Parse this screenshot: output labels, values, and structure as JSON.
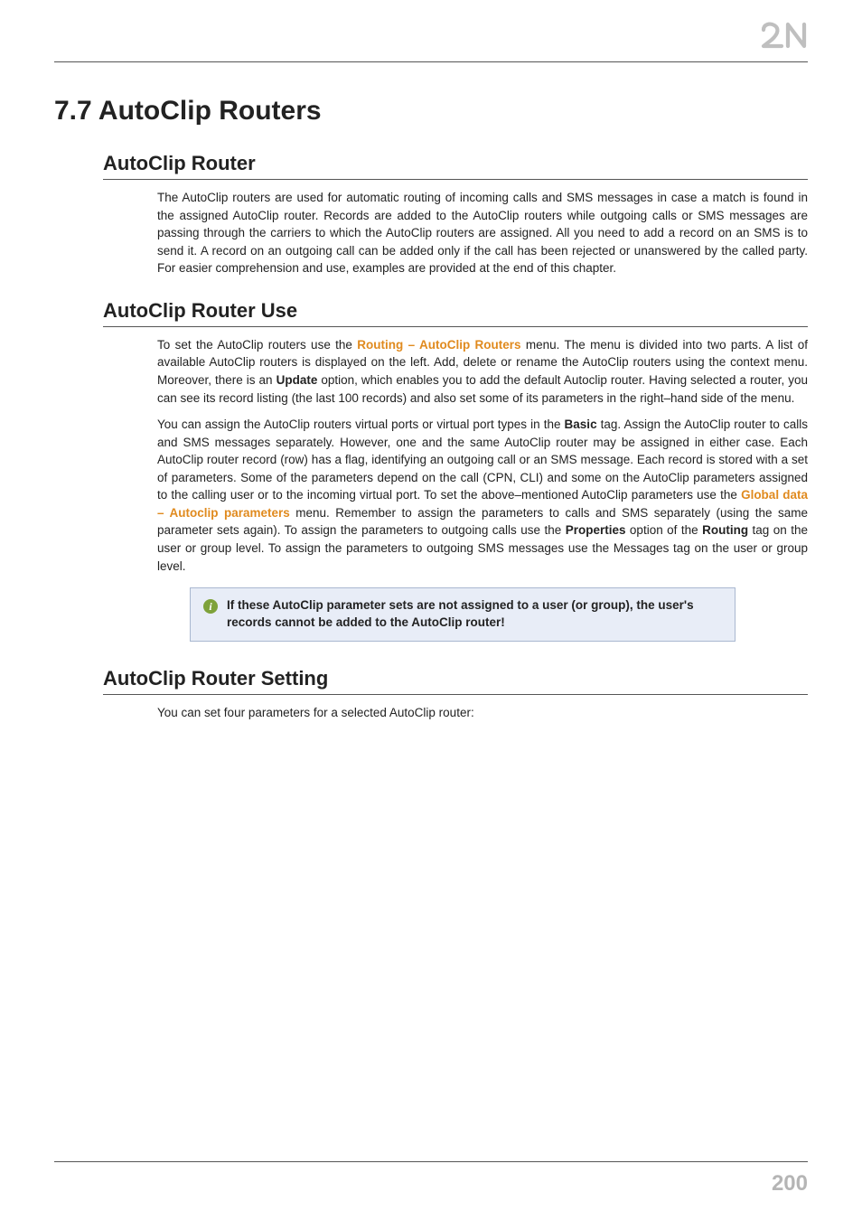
{
  "logo": {
    "name": "brand-logo-2n"
  },
  "page_number": "200",
  "title": "7.7 AutoClip Routers",
  "sections": {
    "s1": {
      "heading": "AutoClip Router",
      "p1a": "The AutoClip routers are used for automatic routing of incoming calls and SMS messages in case a match is found in the assigned AutoClip router. Records are added to the AutoClip routers while outgoing calls or SMS messages are passing through the carriers to which the AutoClip routers are assigned. All you need to add a record on an SMS is to send it. A record on an outgoing call can be added only if the call has been rejected or unanswered by the called party. For easier comprehension and use, examples are provided at the end of this chapter."
    },
    "s2": {
      "heading": "AutoClip Router Use",
      "p1_a": "To set the AutoClip routers use the ",
      "p1_link": "Routing – AutoClip Routers",
      "p1_b": " menu. The menu is divided into two parts. A list of available AutoClip routers is displayed on the left. Add, delete or rename the AutoClip routers using the context menu. Moreover, there is an  ",
      "p1_bold1": "Update",
      "p1_c": " option, which enables you to add the default Autoclip router. Having selected a router, you can see its record listing (the last 100 records) and also set some of its parameters in the right–hand side of the menu.",
      "p2_a": "You can assign the AutoClip routers virtual ports or virtual port types in the ",
      "p2_bold1": "Basic",
      "p2_b": " tag. Assign the AutoClip router to calls and SMS messages separately. However, one and the same AutoClip router may be assigned in either case. Each AutoClip router record (row) has a flag, identifying an outgoing call or an SMS message. Each record is stored with a set of parameters. Some of the parameters depend on the call (CPN, CLI) and some on the AutoClip parameters assigned to the calling user or to the incoming virtual port. To set the above–mentioned AutoClip parameters use the ",
      "p2_link": "Global data – Autoclip parameters",
      "p2_c": " menu. Remember to assign the parameters to calls and SMS separately (using the same parameter sets again). To assign the parameters to outgoing calls use the ",
      "p2_bold2": "Properties",
      "p2_d": " option of the ",
      "p2_bold3": "Routing",
      "p2_e": " tag on the user or group level. To assign the parameters to outgoing SMS messages use the Messages tag on the user or group level.",
      "callout": "If these AutoClip parameter sets are not assigned to a user (or group), the user's records cannot be added to the AutoClip router!"
    },
    "s3": {
      "heading": "AutoClip Router Setting",
      "p1": "You can set four parameters for a selected AutoClip router:"
    }
  }
}
